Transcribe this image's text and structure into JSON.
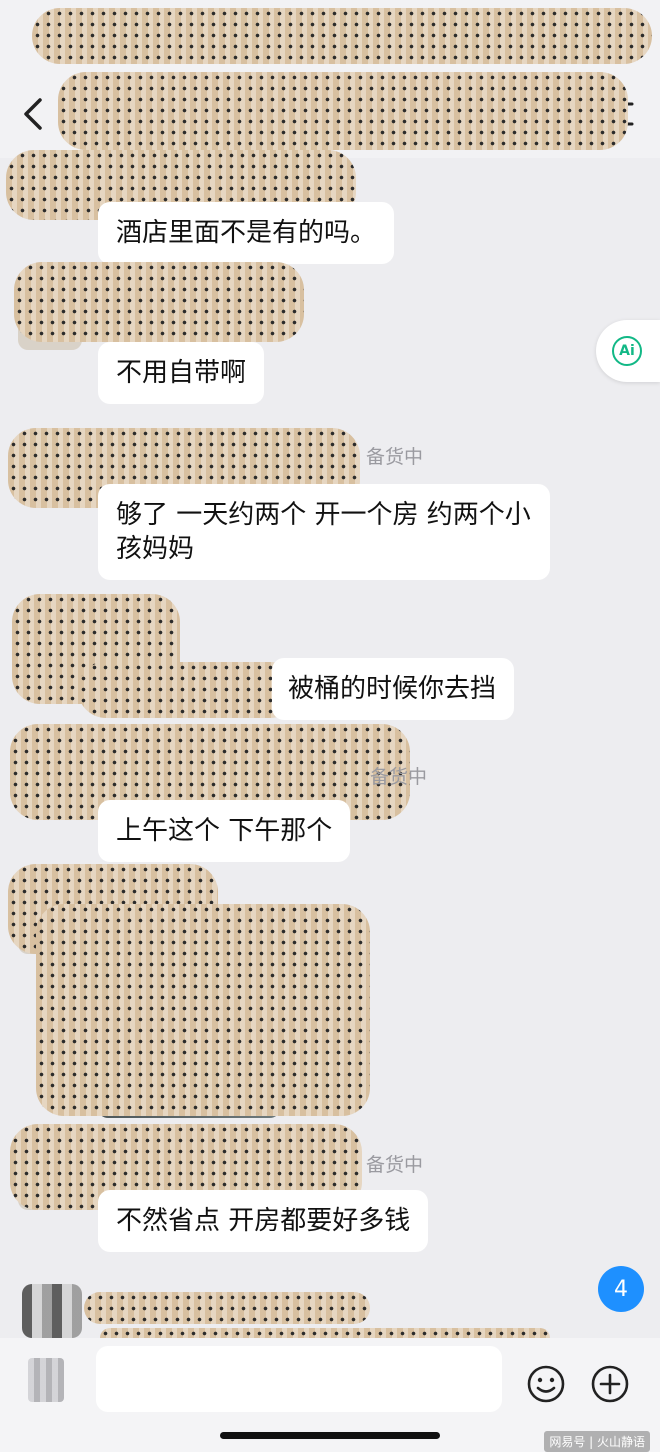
{
  "messages": [
    {
      "text": "酒店里面不是有的吗。"
    },
    {
      "text": "不用自带啊"
    },
    {
      "status": "备货中",
      "text": "够了 一天约两个  开一个房 约两个小孩妈妈"
    },
    {
      "text": "被桶的时候你去挡"
    },
    {
      "status": "备货中",
      "text": "上午这个  下午那个"
    },
    {
      "status": "备货中",
      "text": "不然省点 开房都要好多钱"
    }
  ],
  "ai_button": {
    "label": "Ai"
  },
  "unread_count": "4",
  "input": {
    "value": "",
    "placeholder": ""
  },
  "watermark": "网易号 | 火山静语",
  "colors": {
    "accent": "#12b886",
    "badge": "#1e90ff",
    "redaction": "#d8c0a0"
  },
  "icons": [
    "back-icon",
    "menu-icon",
    "ai-icon",
    "emoji-icon",
    "plus-icon",
    "voice-icon"
  ]
}
